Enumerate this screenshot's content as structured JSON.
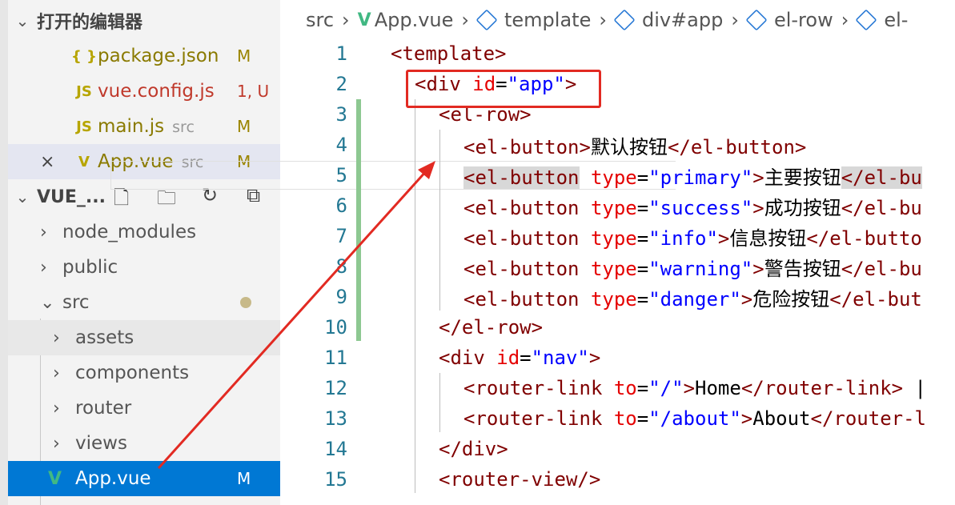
{
  "explorer": {
    "open_editors_title": "打开的编辑器",
    "open_editors": [
      {
        "icon": "{ }",
        "name": "package.json",
        "sub": "",
        "status": "M"
      },
      {
        "icon": "JS",
        "name": "vue.config.js",
        "sub": "",
        "status": "1, U"
      },
      {
        "icon": "JS",
        "name": "main.js",
        "sub": "src",
        "status": "M"
      },
      {
        "icon": "V",
        "name": "App.vue",
        "sub": "src",
        "status": "M",
        "close": "×"
      }
    ],
    "project_title": "VUE_...",
    "tree": [
      {
        "label": "node_modules",
        "chev": "›"
      },
      {
        "label": "public",
        "chev": "›"
      },
      {
        "label": "src",
        "chev": "⌄"
      },
      {
        "label": "assets",
        "chev": "›"
      },
      {
        "label": "components",
        "chev": "›"
      },
      {
        "label": "router",
        "chev": "›"
      },
      {
        "label": "views",
        "chev": "›"
      },
      {
        "label": "App.vue",
        "status": "M"
      }
    ]
  },
  "breadcrumb": [
    "src",
    "App.vue",
    "template",
    "div#app",
    "el-row",
    "el-"
  ],
  "code_lines": [
    "1",
    "2",
    "3",
    "4",
    "5",
    "6",
    "7",
    "8",
    "9",
    "10",
    "11",
    "12",
    "13",
    "14",
    "15"
  ],
  "colors": {
    "accent": "#0078d4",
    "vue": "#41b883",
    "highlight": "#e22a22"
  }
}
